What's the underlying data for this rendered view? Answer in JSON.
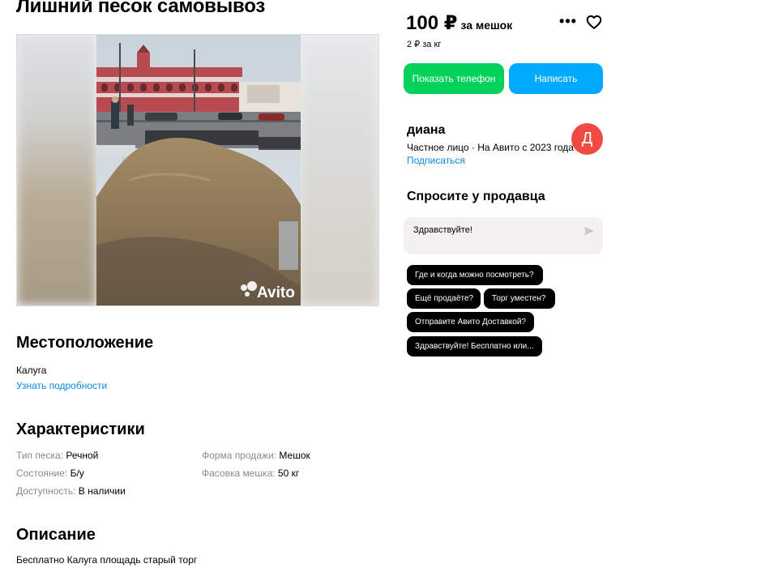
{
  "listing": {
    "title": "Лишний песок самовывоз"
  },
  "gallery": {
    "watermark": "Avito"
  },
  "location": {
    "heading": "Местоположение",
    "city": "Калуга",
    "details_link": "Узнать подробности"
  },
  "characteristics": {
    "heading": "Характеристики",
    "items": [
      {
        "label": "Тип песка:",
        "value": "Речной"
      },
      {
        "label": "Состояние:",
        "value": "Б/у"
      },
      {
        "label": "Доступность:",
        "value": "В наличии"
      },
      {
        "label": "Форма продажи:",
        "value": "Мешок"
      },
      {
        "label": "Фасовка мешка:",
        "value": "50 кг"
      }
    ]
  },
  "description": {
    "heading": "Описание",
    "text": "Бесплатно Калуга площадь старый торг"
  },
  "price": {
    "amount": "100 ₽",
    "unit": "за мешок",
    "per_kg": "2 ₽ за кг"
  },
  "actions": {
    "more_icon": "more-dots-icon",
    "favorite_icon": "heart-icon",
    "show_phone": "Показать телефон",
    "write": "Написать"
  },
  "seller": {
    "name": "диана",
    "info": "Частное лицо · На Авито с 2023 года",
    "subscribe": "Подписаться",
    "avatar_letter": "Д",
    "avatar_color": "#ef4b43"
  },
  "ask": {
    "heading": "Спросите у продавца",
    "message": "Здравствуйте!",
    "send_icon": "send-icon",
    "chips": [
      "Где и когда можно посмотреть?",
      "Ещё продаёте?",
      "Торг уместен?",
      "Отправите Авито Доставкой?",
      "Здравствуйте! Бесплатно или..."
    ]
  },
  "colors": {
    "green": "#02d15c",
    "blue": "#00aaff",
    "link": "#0a8be0"
  }
}
